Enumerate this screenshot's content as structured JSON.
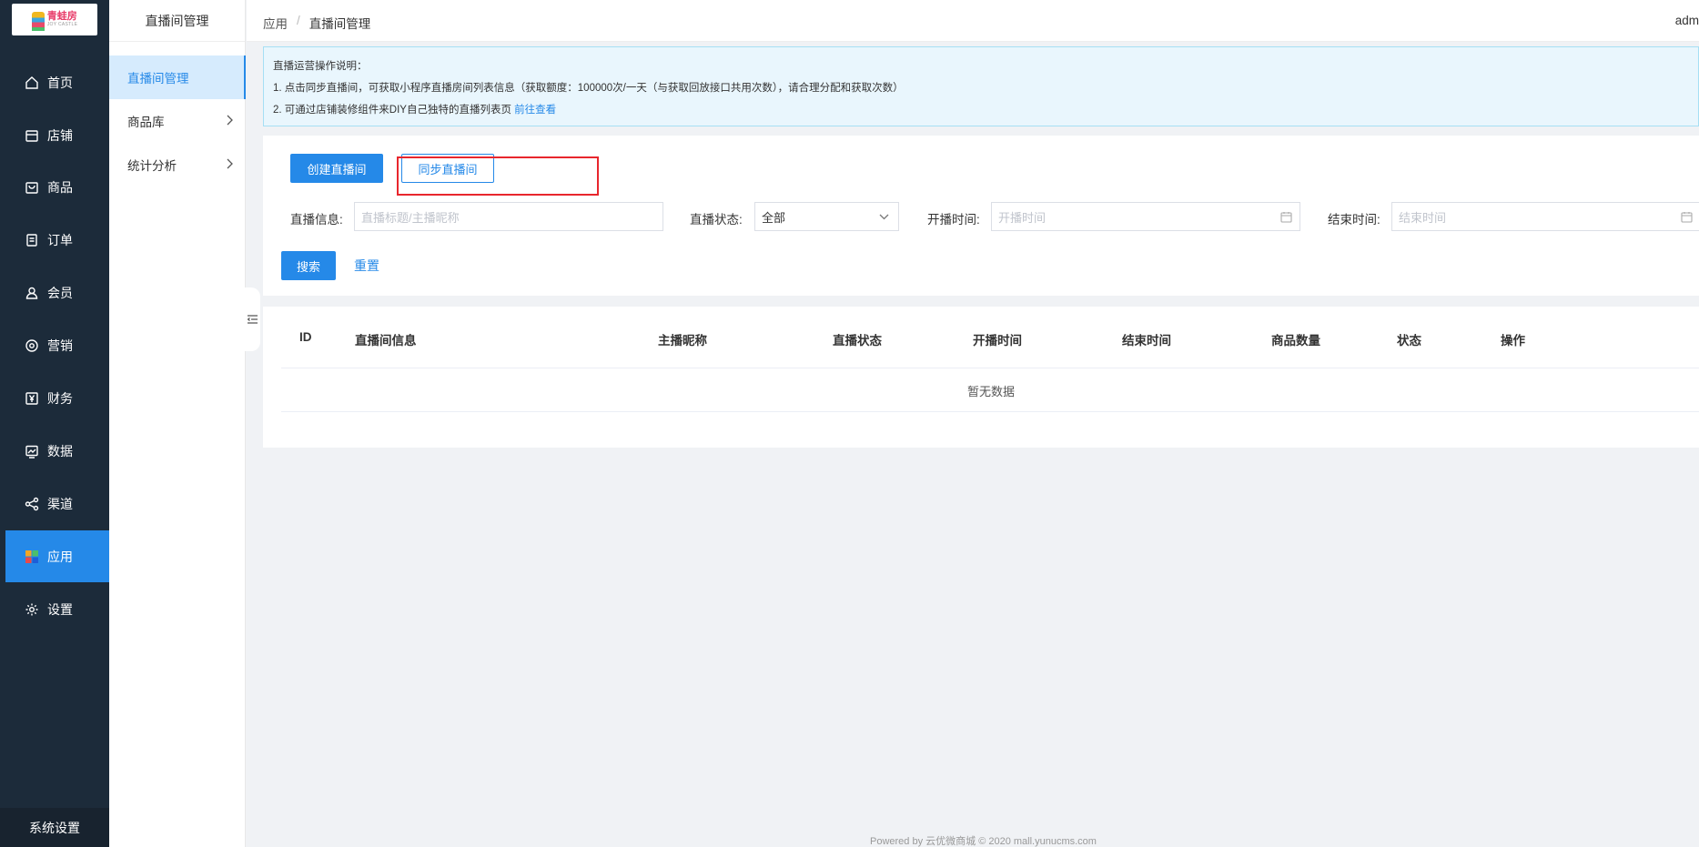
{
  "nav": {
    "logo_text": "青蛙房",
    "logo_sub": "JOY CASTLE",
    "items": [
      {
        "label": "首页",
        "icon": "home-icon"
      },
      {
        "label": "店铺",
        "icon": "store-icon"
      },
      {
        "label": "商品",
        "icon": "bag-icon"
      },
      {
        "label": "订单",
        "icon": "order-icon"
      },
      {
        "label": "会员",
        "icon": "user-icon"
      },
      {
        "label": "营销",
        "icon": "marketing-icon"
      },
      {
        "label": "财务",
        "icon": "finance-icon"
      },
      {
        "label": "数据",
        "icon": "data-icon"
      },
      {
        "label": "渠道",
        "icon": "channel-icon"
      },
      {
        "label": "应用",
        "icon": "apps-icon",
        "active": true
      },
      {
        "label": "设置",
        "icon": "gear-icon"
      }
    ],
    "bottom_label": "系统设置",
    "active_color": "#2589e8"
  },
  "submenu": {
    "title": "直播间管理",
    "items": [
      {
        "label": "直播间管理",
        "active": true
      },
      {
        "label": "商品库"
      },
      {
        "label": "统计分析"
      }
    ]
  },
  "header": {
    "breadcrumb": [
      "应用",
      "直播间管理"
    ],
    "user": "adm"
  },
  "notice": {
    "title": "直播运营操作说明：",
    "line1": "1. 点击同步直播间，可获取小程序直播房间列表信息（获取额度：100000次/一天（与获取回放接口共用次数），请合理分配和获取次数）",
    "line2": "2. 可通过店铺装修组件来DIY自己独特的直播列表页",
    "line2_link": "前往查看"
  },
  "toolbar": {
    "create_label": "创建直播间",
    "sync_label": "同步直播间"
  },
  "filters": {
    "info_label": "直播信息:",
    "info_placeholder": "直播标题/主播昵称",
    "status_label": "直播状态:",
    "status_value": "全部",
    "start_label": "开播时间:",
    "start_placeholder": "开播时间",
    "end_label": "结束时间:",
    "end_placeholder": "结束时间",
    "search_label": "搜索",
    "reset_label": "重置"
  },
  "table": {
    "columns": [
      "ID",
      "直播间信息",
      "主播昵称",
      "直播状态",
      "开播时间",
      "结束时间",
      "商品数量",
      "状态",
      "操作"
    ],
    "empty_text": "暂无数据"
  },
  "footer": "Powered by 云优微商城 © 2020 mall.yunucms.com",
  "colors": {
    "primary": "#2589e8",
    "nav_bg": "#1c2b3a",
    "highlight": "#e8262d"
  }
}
